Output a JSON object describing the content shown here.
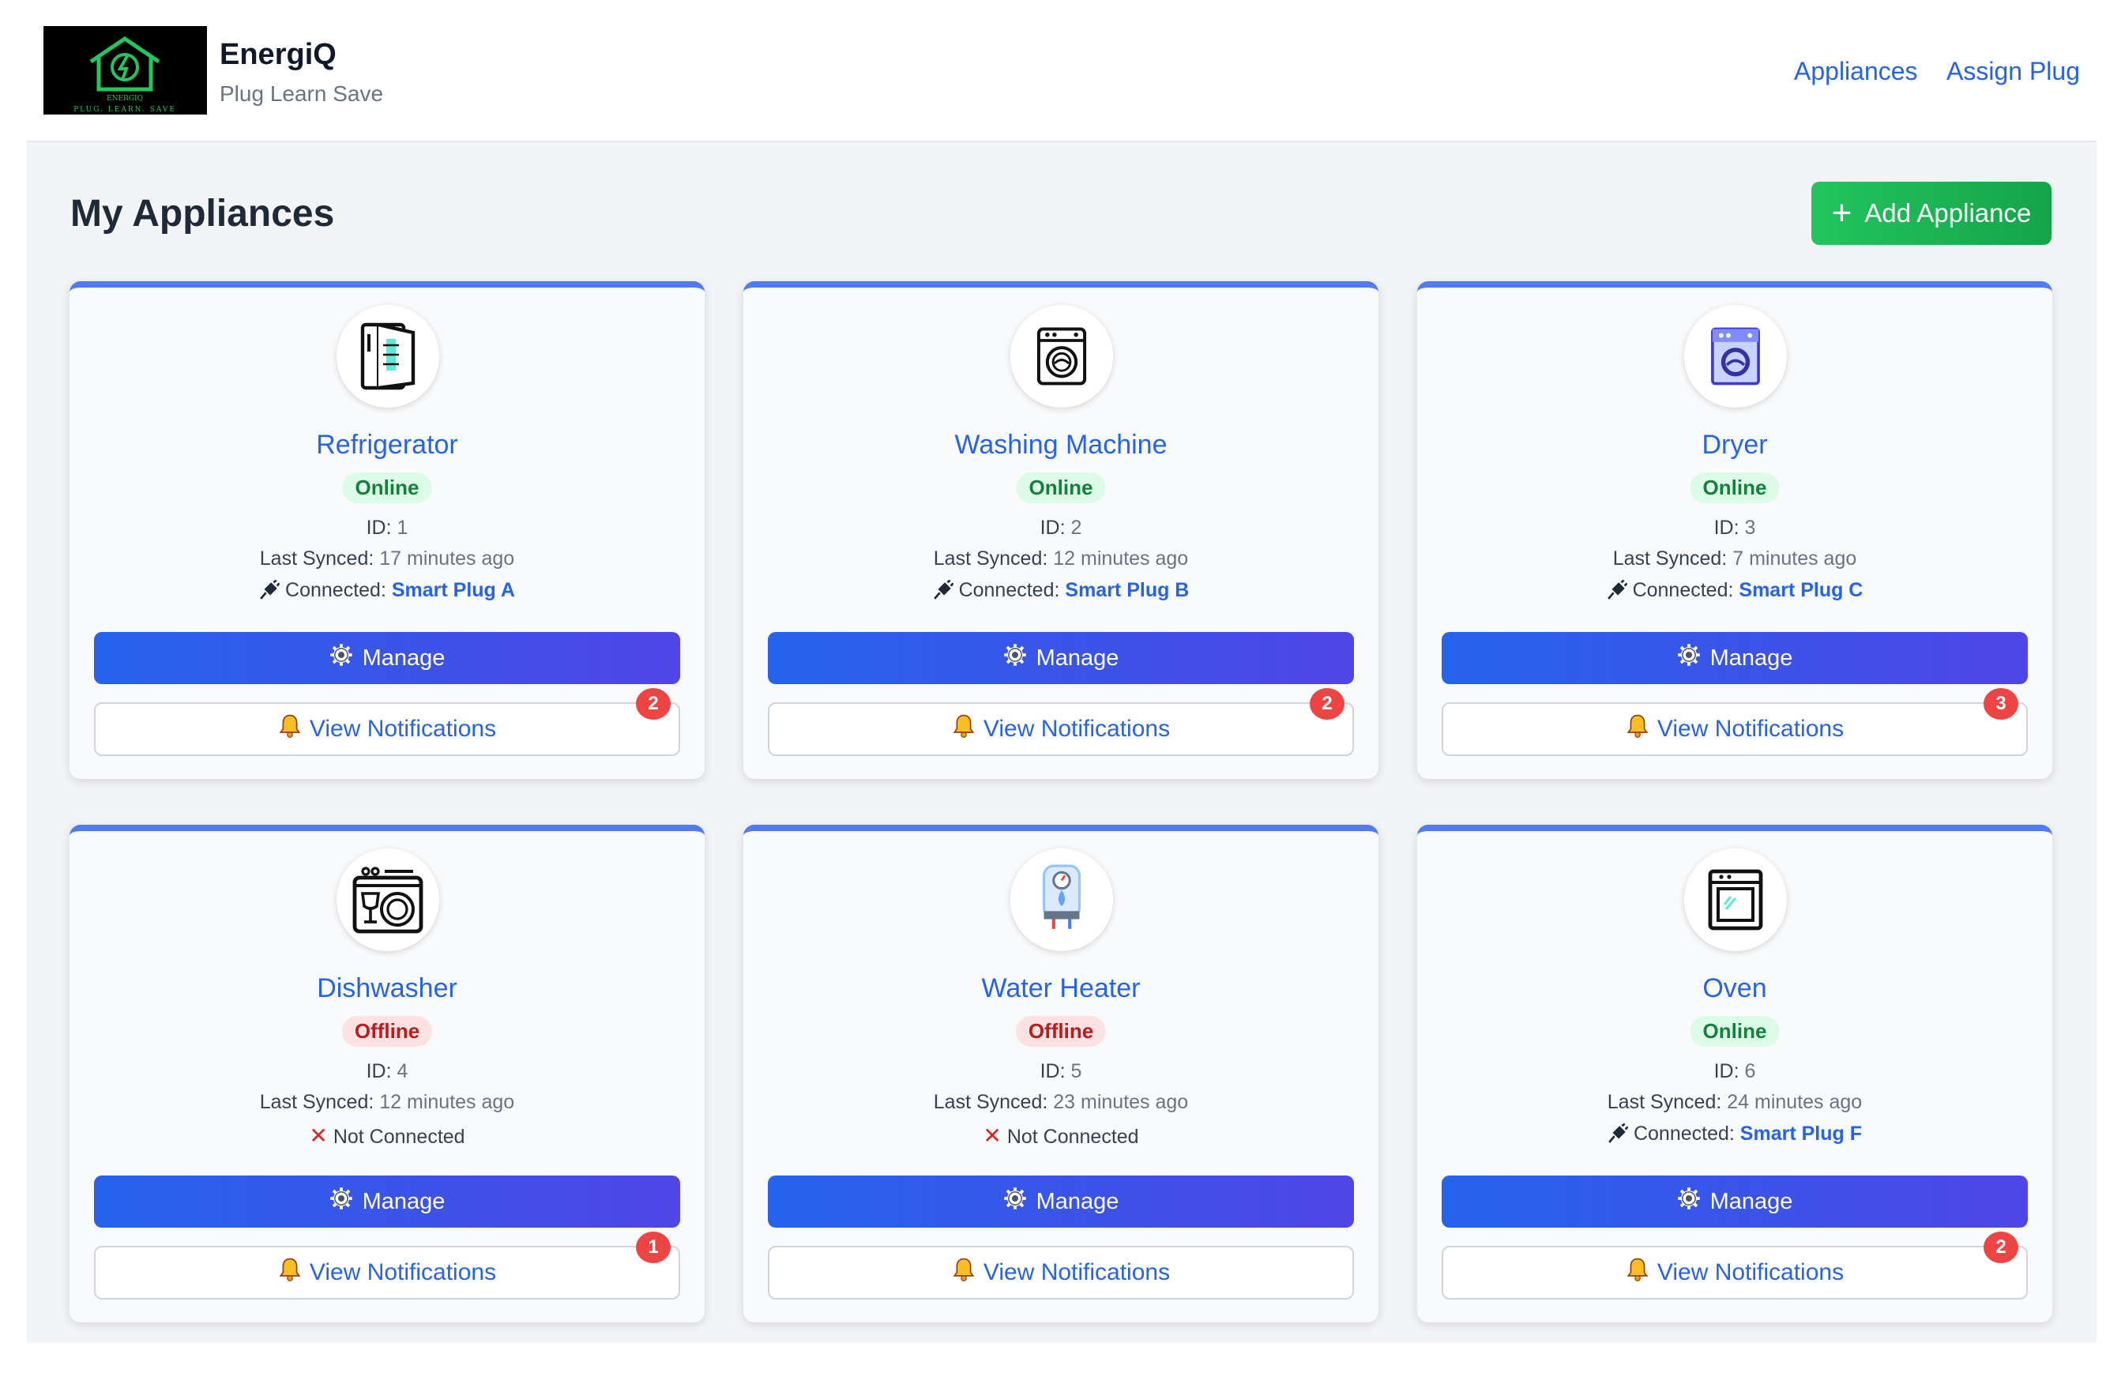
{
  "header": {
    "brand_name": "EnergiQ",
    "brand_tagline": "Plug Learn Save",
    "logo_text": "ENERGIQ",
    "logo_subtext": "PLUG. LEARN. SAVE",
    "nav": [
      {
        "label": "Appliances"
      },
      {
        "label": "Assign Plug"
      }
    ]
  },
  "main": {
    "title": "My Appliances",
    "add_button_label": "Add Appliance"
  },
  "labels": {
    "id_prefix": "ID:",
    "last_synced_prefix": "Last Synced:",
    "connected_prefix": "Connected:",
    "not_connected": "Not Connected",
    "manage": "Manage",
    "view_notifications": "View Notifications"
  },
  "appliances": [
    {
      "name": "Refrigerator",
      "status": "Online",
      "id": "1",
      "last_synced": "17 minutes ago",
      "connected": true,
      "plug": "Smart Plug A",
      "notifications": "2",
      "icon": "refrigerator-icon"
    },
    {
      "name": "Washing Machine",
      "status": "Online",
      "id": "2",
      "last_synced": "12 minutes ago",
      "connected": true,
      "plug": "Smart Plug B",
      "notifications": "2",
      "icon": "washing-machine-icon"
    },
    {
      "name": "Dryer",
      "status": "Online",
      "id": "3",
      "last_synced": "7 minutes ago",
      "connected": true,
      "plug": "Smart Plug C",
      "notifications": "3",
      "icon": "dryer-icon"
    },
    {
      "name": "Dishwasher",
      "status": "Offline",
      "id": "4",
      "last_synced": "12 minutes ago",
      "connected": false,
      "plug": "",
      "notifications": "1",
      "icon": "dishwasher-icon"
    },
    {
      "name": "Water Heater",
      "status": "Offline",
      "id": "5",
      "last_synced": "23 minutes ago",
      "connected": false,
      "plug": "",
      "notifications": "",
      "icon": "water-heater-icon"
    },
    {
      "name": "Oven",
      "status": "Online",
      "id": "6",
      "last_synced": "24 minutes ago",
      "connected": true,
      "plug": "Smart Plug F",
      "notifications": "2",
      "icon": "oven-icon"
    }
  ],
  "colors": {
    "accent_blue": "#2563eb",
    "indigo": "#4f46e5",
    "green": "#22c55e",
    "online_bg": "#dcfce7",
    "online_text": "#15803d",
    "offline_bg": "#fee2e2",
    "offline_text": "#b91c1c",
    "badge_red": "#ef4444"
  }
}
